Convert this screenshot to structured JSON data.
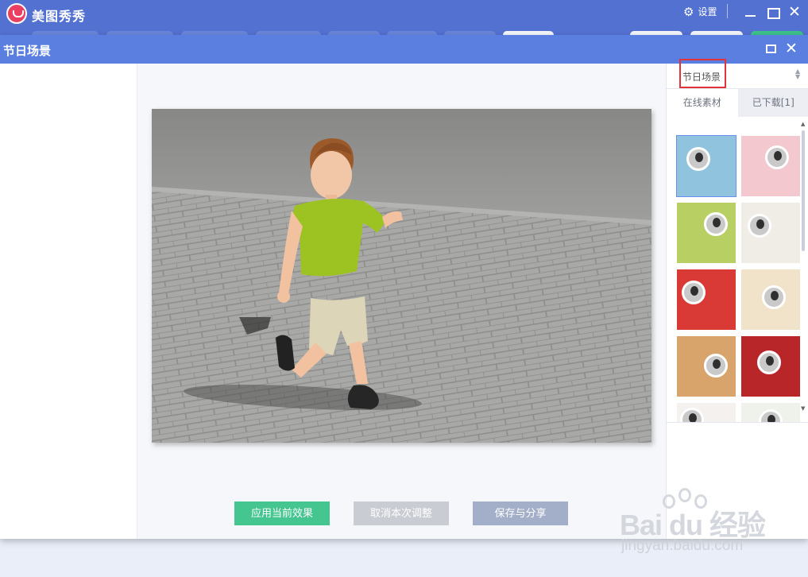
{
  "app": {
    "name": "美图秀秀",
    "settings_label": "设置"
  },
  "dialog": {
    "title": "节日场景"
  },
  "category": {
    "selected": "节日场景"
  },
  "tabs": [
    {
      "label": "在线素材"
    },
    {
      "label": "已下载[1]"
    }
  ],
  "actions": {
    "apply": "应用当前效果",
    "cancel": "取消本次调整",
    "save": "保存与分享"
  },
  "thumbnails": [
    {
      "theme": "blue-scene",
      "color": "#8fc3de"
    },
    {
      "theme": "pink-flowers",
      "color": "#f3c8cf"
    },
    {
      "theme": "green-blocks",
      "color": "#b8cf63"
    },
    {
      "theme": "orange-frame",
      "color": "#f0ece6"
    },
    {
      "theme": "red-newyear",
      "color": "#d93a35"
    },
    {
      "theme": "spring-animals",
      "color": "#f1e3c9"
    },
    {
      "theme": "brown-scroll",
      "color": "#d9a46b"
    },
    {
      "theme": "red-lantern",
      "color": "#b8262a"
    },
    {
      "theme": "red-white",
      "color": "#f5f1ee"
    },
    {
      "theme": "pale-cloud",
      "color": "#eef2ea"
    }
  ],
  "watermark": {
    "brand": "Bai du 经验",
    "url": "jingyan.baidu.com"
  },
  "colors": {
    "titlebar": "#5371d1",
    "dialog_header": "#5a7fe0",
    "apply": "#45c58f",
    "cancel": "#c9ccd3",
    "save": "#a3aec8",
    "highlight": "#e0343a"
  }
}
